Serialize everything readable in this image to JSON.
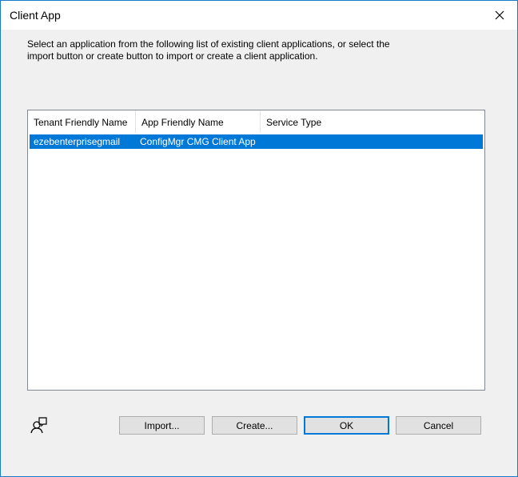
{
  "window": {
    "title": "Client App"
  },
  "description": "Select an application from the following list of existing client applications, or select the import button or create button to import or create a client application.",
  "table": {
    "columns": [
      "Tenant Friendly Name",
      "App Friendly Name",
      "Service Type"
    ],
    "rows": [
      {
        "tenant": "ezebenterprisegmail",
        "app": "ConfigMgr CMG Client App",
        "service": ""
      }
    ]
  },
  "buttons": {
    "import": "Import...",
    "create": "Create...",
    "ok": "OK",
    "cancel": "Cancel"
  },
  "colors": {
    "selection": "#0078d7",
    "window_border": "#1979ca"
  },
  "icons": {
    "close": "close-icon",
    "help": "user-help-icon"
  }
}
